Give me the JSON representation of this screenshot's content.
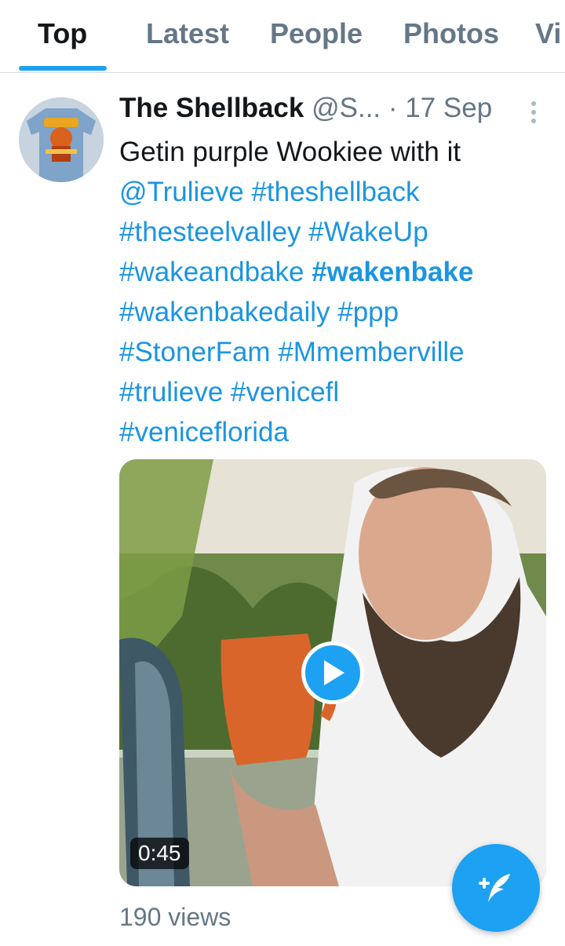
{
  "tabs": [
    {
      "label": "Top",
      "active": true
    },
    {
      "label": "Latest",
      "active": false
    },
    {
      "label": "People",
      "active": false
    },
    {
      "label": "Photos",
      "active": false
    },
    {
      "label": "Vi",
      "active": false
    }
  ],
  "tweet": {
    "author_name": "The Shellback",
    "handle": "@S...",
    "time": " · 17 Sep",
    "text_line1": "Getin purple Wookiee with it",
    "links": [
      "@Trulieve",
      "#theshellback",
      "#thesteelvalley",
      "#WakeUp",
      "#wakeandbake",
      "#wakenbake",
      "#wakenbakedaily",
      "#ppp",
      "#StonerFam",
      "#Mmemberville",
      "#trulieve",
      "#venicefl",
      "#veniceflorida"
    ],
    "video_duration": "0:45",
    "views": "190 views"
  },
  "colors": {
    "accent": "#1da1f2",
    "link": "#1b95e0",
    "muted": "#657786"
  },
  "icons": {
    "more": "vertical-ellipsis-icon",
    "play": "play-icon",
    "compose": "compose-tweet-icon"
  }
}
